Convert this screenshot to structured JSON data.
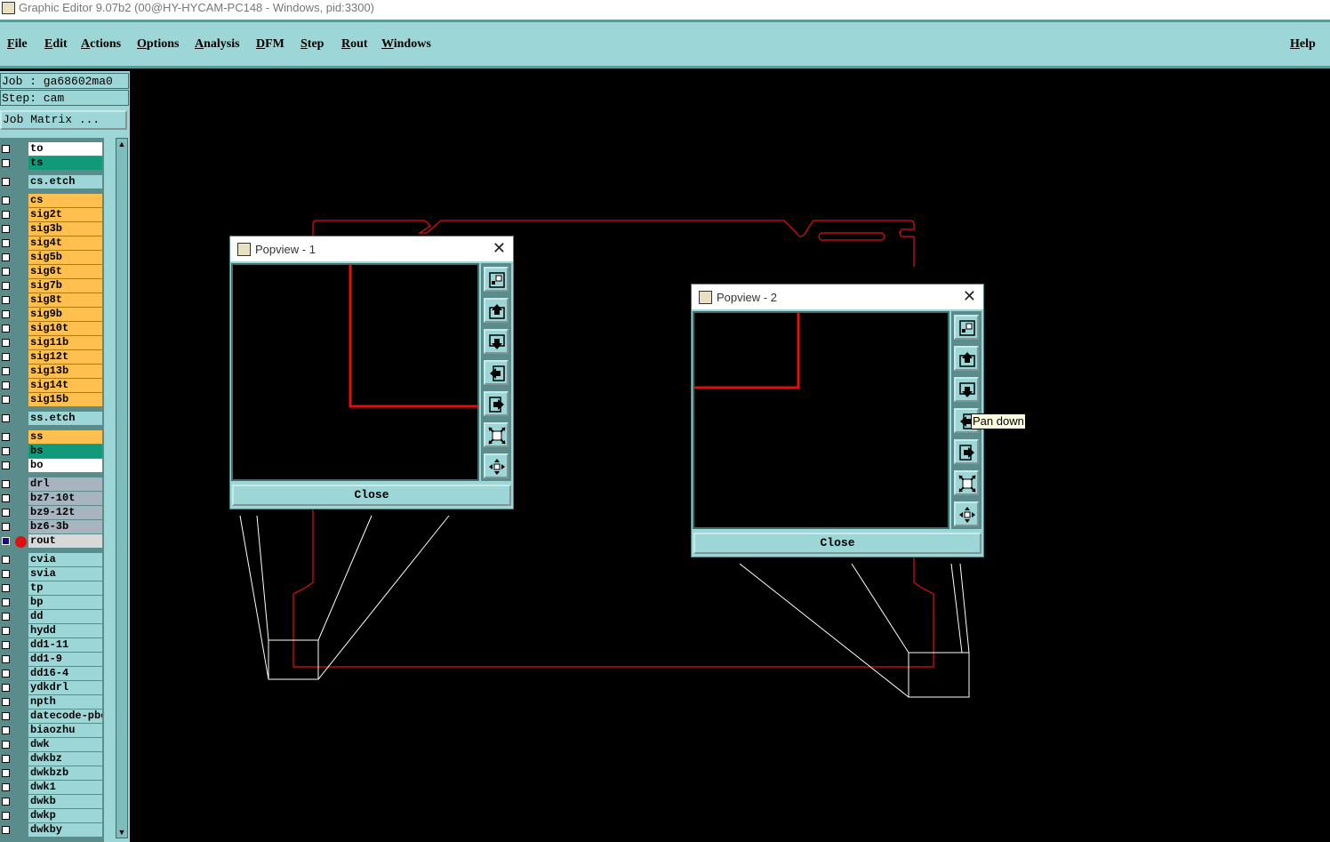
{
  "window": {
    "title": "Graphic Editor 9.07b2 (00@HY-HYCAM-PC148 - Windows, pid:3300)"
  },
  "menu": {
    "items": [
      "File",
      "Edit",
      "Actions",
      "Options",
      "Analysis",
      "DFM",
      "Step",
      "Rout",
      "Windows"
    ],
    "help": "Help"
  },
  "job": {
    "job_line": "Job : ga68602ma0",
    "step_line": "Step: cam",
    "matrix_button": "Job Matrix ..."
  },
  "layers": [
    {
      "name": "to",
      "color": "#ffffff"
    },
    {
      "name": "ts",
      "color": "#109a7a"
    },
    {
      "name": "cs.etch",
      "color": "#9dd6d6"
    },
    {
      "name": "cs",
      "color": "#ffc050"
    },
    {
      "name": "sig2t",
      "color": "#ffc050"
    },
    {
      "name": "sig3b",
      "color": "#ffc050"
    },
    {
      "name": "sig4t",
      "color": "#ffc050"
    },
    {
      "name": "sig5b",
      "color": "#ffc050"
    },
    {
      "name": "sig6t",
      "color": "#ffc050"
    },
    {
      "name": "sig7b",
      "color": "#ffc050"
    },
    {
      "name": "sig8t",
      "color": "#ffc050"
    },
    {
      "name": "sig9b",
      "color": "#ffc050"
    },
    {
      "name": "sig10t",
      "color": "#ffc050"
    },
    {
      "name": "sig11b",
      "color": "#ffc050"
    },
    {
      "name": "sig12t",
      "color": "#ffc050"
    },
    {
      "name": "sig13b",
      "color": "#ffc050"
    },
    {
      "name": "sig14t",
      "color": "#ffc050"
    },
    {
      "name": "sig15b",
      "color": "#ffc050"
    },
    {
      "name": "ss.etch",
      "color": "#9dd6d6"
    },
    {
      "name": "ss",
      "color": "#ffc050"
    },
    {
      "name": "bs",
      "color": "#109a7a"
    },
    {
      "name": "bo",
      "color": "#ffffff"
    },
    {
      "name": "drl",
      "color": "#a8b4c0"
    },
    {
      "name": "bz7-10t",
      "color": "#a8b4c0"
    },
    {
      "name": "bz9-12t",
      "color": "#a8b4c0"
    },
    {
      "name": "bz6-3b",
      "color": "#a8b4c0"
    },
    {
      "name": "rout",
      "color": "#d8d8d8",
      "active": true
    },
    {
      "name": "cvia",
      "color": "#9dd6d6"
    },
    {
      "name": "svia",
      "color": "#9dd6d6"
    },
    {
      "name": "tp",
      "color": "#9dd6d6"
    },
    {
      "name": "bp",
      "color": "#9dd6d6"
    },
    {
      "name": "dd",
      "color": "#9dd6d6"
    },
    {
      "name": "hydd",
      "color": "#9dd6d6"
    },
    {
      "name": "dd1-11",
      "color": "#9dd6d6"
    },
    {
      "name": "dd1-9",
      "color": "#9dd6d6"
    },
    {
      "name": "dd16-4",
      "color": "#9dd6d6"
    },
    {
      "name": "ydkdrl",
      "color": "#9dd6d6"
    },
    {
      "name": "npth",
      "color": "#9dd6d6"
    },
    {
      "name": "datecode-pbe",
      "color": "#9dd6d6"
    },
    {
      "name": "biaozhu",
      "color": "#9dd6d6"
    },
    {
      "name": "dwk",
      "color": "#9dd6d6"
    },
    {
      "name": "dwkbz",
      "color": "#9dd6d6"
    },
    {
      "name": "dwkbzb",
      "color": "#9dd6d6"
    },
    {
      "name": "dwk1",
      "color": "#9dd6d6"
    },
    {
      "name": "dwkb",
      "color": "#9dd6d6"
    },
    {
      "name": "dwkp",
      "color": "#9dd6d6"
    },
    {
      "name": "dwkby",
      "color": "#9dd6d6"
    }
  ],
  "popviews": [
    {
      "title": "Popview - 1",
      "close_label": "Close"
    },
    {
      "title": "Popview - 2",
      "close_label": "Close"
    }
  ],
  "tool_icons": [
    "zoom-home-icon",
    "pan-up-icon",
    "pan-down-icon",
    "pan-left-icon",
    "pan-right-icon",
    "zoom-in-icon",
    "zoom-out-icon"
  ],
  "tooltip": "Pan down",
  "colors": {
    "panel": "#9dd6d6",
    "outline": "#e01010",
    "background": "#000000"
  }
}
